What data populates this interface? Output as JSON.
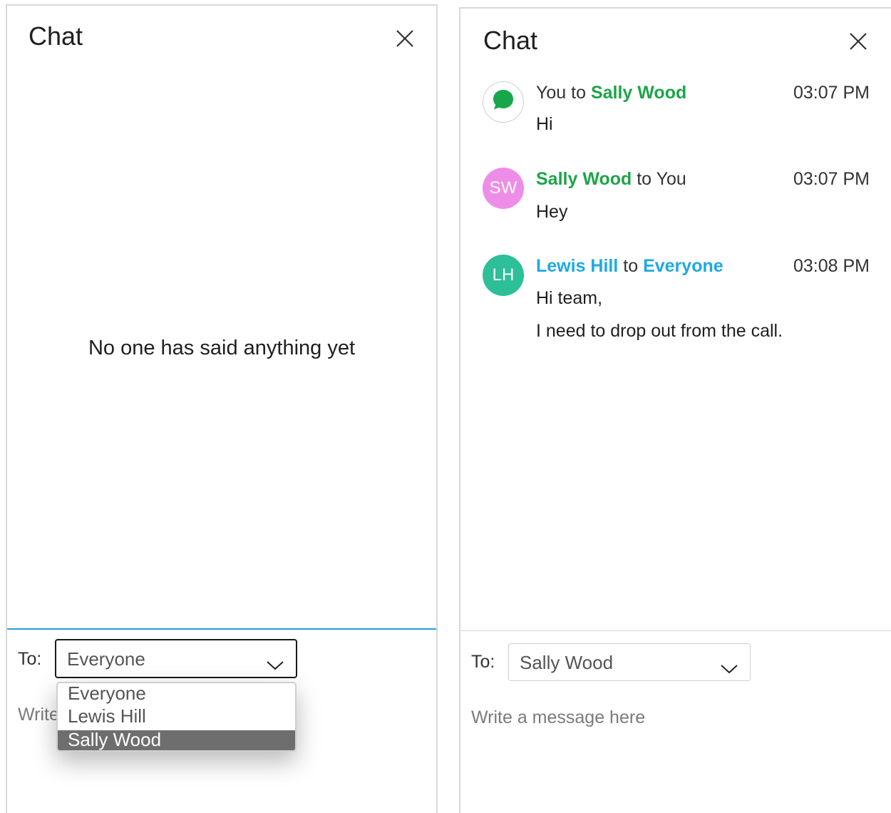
{
  "left_panel": {
    "title": "Chat",
    "empty_message": "No one has said anything yet",
    "to_label": "To:",
    "recipient_value": "Everyone",
    "write_placeholder": "Write",
    "dropdown_options": [
      "Everyone",
      "Lewis Hill",
      "Sally Wood"
    ],
    "selected_option": "Sally Wood",
    "icons": {
      "close": "close-icon",
      "chevron": "chevron-down-icon"
    }
  },
  "right_panel": {
    "title": "Chat",
    "messages": [
      {
        "sender": "You",
        "joiner": "to",
        "recipient": "Sally Wood",
        "time": "03:07 PM",
        "lines": [
          "Hi"
        ],
        "avatar_icon": "chat-bubble-icon"
      },
      {
        "sender": "Sally Wood",
        "joiner": "to",
        "recipient": "You",
        "time": "03:07 PM",
        "lines": [
          "Hey"
        ],
        "avatar_initials": "SW"
      },
      {
        "sender": "Lewis Hill",
        "joiner": "to",
        "recipient": "Everyone",
        "time": "03:08 PM",
        "lines": [
          "Hi team,",
          "I need to drop out from the call."
        ],
        "avatar_initials": "LH"
      }
    ],
    "to_label": "To:",
    "recipient_value": "Sally Wood",
    "write_placeholder": "Write a message here"
  },
  "colors": {
    "green_name": "#1ea448",
    "blue_name": "#1fa9e1",
    "avatar_pink": "#ee8de8",
    "avatar_teal": "#2dbf98",
    "chat_icon_green": "#17a74a",
    "focus_line": "#2a9fd8",
    "selected_option_bg": "#6e6e6e"
  }
}
